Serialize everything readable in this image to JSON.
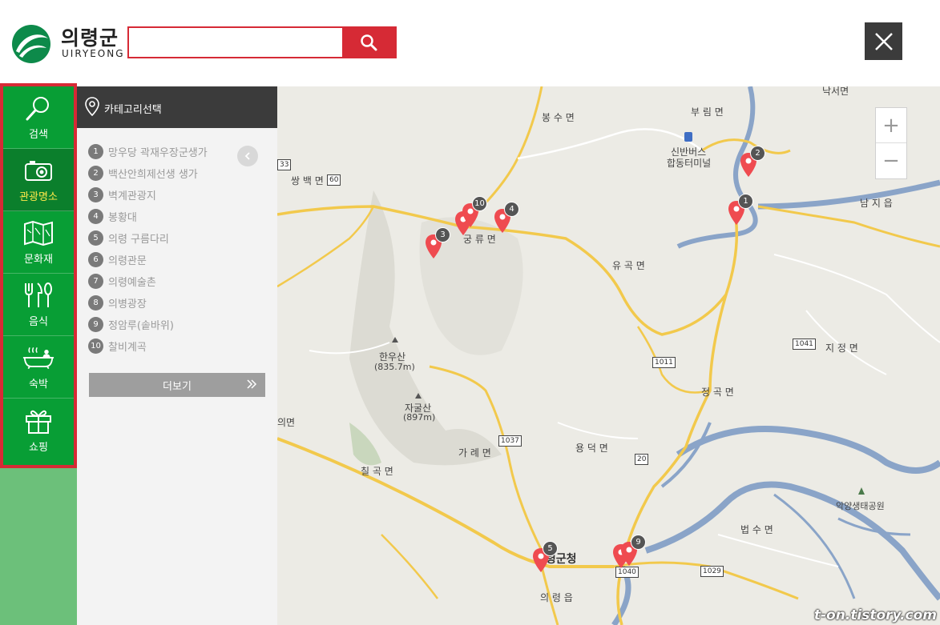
{
  "header": {
    "logo_kr": "의령군",
    "logo_en": "UIRYEONG",
    "search_placeholder": "",
    "search_icon": "search-icon",
    "close_icon": "close-icon"
  },
  "nav": {
    "items": [
      {
        "label": "검색",
        "icon": "search-icon"
      },
      {
        "label": "관광명소",
        "icon": "camera-icon",
        "active": true
      },
      {
        "label": "문화재",
        "icon": "map-icon"
      },
      {
        "label": "음식",
        "icon": "utensils-icon"
      },
      {
        "label": "숙박",
        "icon": "bath-icon"
      },
      {
        "label": "쇼핑",
        "icon": "gift-icon"
      }
    ]
  },
  "panel": {
    "title": "카테고리선택",
    "items": [
      {
        "num": "1",
        "label": "망우당 곽재우장군생가"
      },
      {
        "num": "2",
        "label": "백산안희제선생 생가"
      },
      {
        "num": "3",
        "label": "벽계관광지"
      },
      {
        "num": "4",
        "label": "봉황대"
      },
      {
        "num": "5",
        "label": "의령 구름다리"
      },
      {
        "num": "6",
        "label": "의령관문"
      },
      {
        "num": "7",
        "label": "의령예술촌"
      },
      {
        "num": "8",
        "label": "의병광장"
      },
      {
        "num": "9",
        "label": "정암루(솥바위)"
      },
      {
        "num": "10",
        "label": "찰비계곡"
      }
    ],
    "more_label": "더보기"
  },
  "map": {
    "labels": {
      "nakseo": "낙서면",
      "burim": "부 림 면",
      "bongsu": "봉 수 면",
      "bus": "신반버스",
      "terminal": "합동터미널",
      "ssangbaek": "쌍 백 면",
      "namji": "남 지 읍",
      "gungryu": "궁 류 면",
      "yugok": "유 곡 면",
      "jijeong": "지 정 면",
      "hanusan": "한우산",
      "hanusan_h": "(835.7m)",
      "jagulsan": "자굴산",
      "jagulsan_h": "(897m)",
      "jeonggok": "정 곡 면",
      "uimyeon": "의면",
      "garye": "가 례 면",
      "yongdeok": "용 덕 면",
      "chilgok": "칠 곡 면",
      "ecopark": "악양생태공원",
      "beopsu": "법 수 면",
      "gunhall": "의령군청",
      "uiryeong_eup": "의 령 읍"
    },
    "road_signs": [
      "33",
      "60",
      "1011",
      "1041",
      "1037",
      "20",
      "1040",
      "1029"
    ],
    "markers": [
      "1",
      "2",
      "3",
      "4",
      "5",
      "9",
      "10"
    ],
    "zoom_in": "+",
    "zoom_out": "−"
  },
  "watermark": "t-on.tistory.com",
  "colors": {
    "accent_red": "#d62a35",
    "nav_green": "#089e35",
    "active_yellow": "#ffe94a"
  }
}
